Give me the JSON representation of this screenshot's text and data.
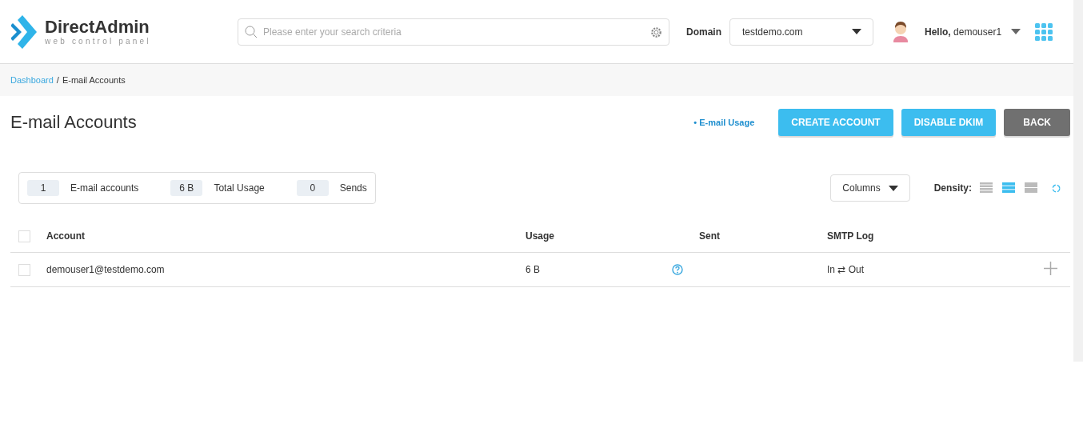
{
  "logo": {
    "name": "DirectAdmin",
    "tagline": "web control panel"
  },
  "search": {
    "placeholder": "Please enter your search criteria"
  },
  "domain": {
    "label": "Domain",
    "value": "testdemo.com"
  },
  "user": {
    "greeting": "Hello,",
    "name": "demouser1"
  },
  "breadcrumb_separator": "/",
  "breadcrumb": [
    {
      "label": "Dashboard",
      "link": true
    },
    {
      "label": "E-mail Accounts",
      "link": false
    }
  ],
  "page_title": "E-mail Accounts",
  "actions": {
    "link": "• E-mail Usage",
    "buttons": [
      {
        "label": "CREATE ACCOUNT",
        "kind": "primary"
      },
      {
        "label": "DISABLE DKIM",
        "kind": "primary"
      },
      {
        "label": "BACK",
        "kind": "secondary"
      }
    ]
  },
  "stats": [
    {
      "value": "1",
      "label": "E-mail accounts"
    },
    {
      "value": "6 B",
      "label": "Total Usage"
    },
    {
      "value": "0",
      "label": "Sends"
    }
  ],
  "columns_button": "Columns",
  "density": {
    "label": "Density:",
    "options": [
      {
        "kind": "compact",
        "selected": false
      },
      {
        "kind": "normal",
        "selected": true
      },
      {
        "kind": "wide",
        "selected": false
      }
    ]
  },
  "table": {
    "header_checked": false,
    "columns": [
      "Account",
      "Usage",
      "Sent",
      "SMTP Log"
    ],
    "rows": [
      {
        "checked": false,
        "account": "demouser1@testdemo.com",
        "usage": "6 B",
        "smtp_log": "In ⇄ Out"
      }
    ]
  }
}
